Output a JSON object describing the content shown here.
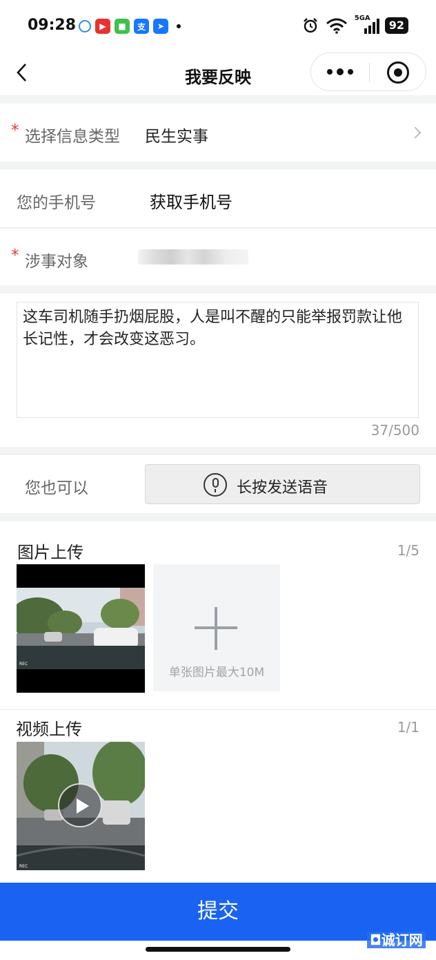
{
  "status_bar": {
    "time": "09:28",
    "network": "5GA",
    "battery": "92"
  },
  "nav": {
    "title": "我要反映"
  },
  "form": {
    "info_type": {
      "label": "选择信息类型",
      "required_mark": "*",
      "value": "民生实事"
    },
    "phone": {
      "label": "您的手机号",
      "value": "获取手机号"
    },
    "subject": {
      "label": "涉事对象",
      "required_mark": "*"
    }
  },
  "description": {
    "text": "这车司机随手扔烟屁股，人是叫不醒的只能举报罚款让他长记性，才会改变这恶习。",
    "count": "37/500"
  },
  "voice": {
    "label": "您也可以",
    "button_label": "长按发送语音"
  },
  "image_upload": {
    "title": "图片上传",
    "count": "1/5",
    "add_hint": "单张图片最大10M"
  },
  "video_upload": {
    "title": "视频上传",
    "count": "1/1"
  },
  "submit_label": "提交",
  "watermark": "◘诚订网",
  "colors": {
    "primary": "#1a63f2",
    "required": "#e03a3a",
    "page_bg": "#f1f4f3"
  }
}
